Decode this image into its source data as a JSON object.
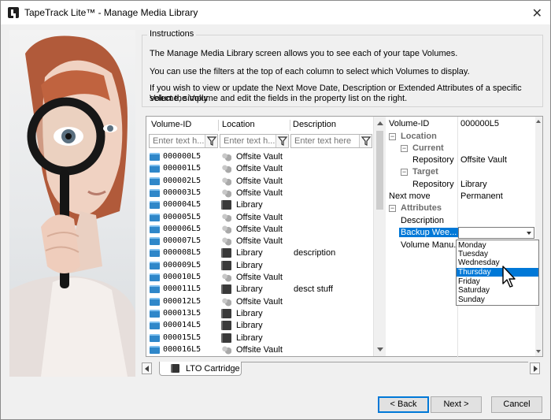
{
  "window": {
    "title": "TapeTrack Lite™ - Manage Media Library"
  },
  "instructions": {
    "legend": "Instructions",
    "p1": "The Manage Media Library screen allows you to see each of your tape Volumes.",
    "p2": "You can use the filters at the top of each column to select which Volumes to display.",
    "p3a": "If you wish to view or update the Next Move Date, Description or Extended Attributes of a specific Volume, simply",
    "p3b": "select the Volume and edit the fields in the property list on the right."
  },
  "grid": {
    "columns": [
      "Volume-ID",
      "Location",
      "Description"
    ],
    "filter_placeholders": [
      "Enter text h...",
      "Enter text h...",
      "Enter text here"
    ],
    "rows": [
      {
        "id": "000000L5",
        "location": "Offsite Vault",
        "loc_type": "offsite",
        "description": ""
      },
      {
        "id": "000001L5",
        "location": "Offsite Vault",
        "loc_type": "offsite",
        "description": ""
      },
      {
        "id": "000002L5",
        "location": "Offsite Vault",
        "loc_type": "offsite",
        "description": ""
      },
      {
        "id": "000003L5",
        "location": "Offsite Vault",
        "loc_type": "offsite",
        "description": ""
      },
      {
        "id": "000004L5",
        "location": "Library",
        "loc_type": "library",
        "description": ""
      },
      {
        "id": "000005L5",
        "location": "Offsite Vault",
        "loc_type": "offsite",
        "description": ""
      },
      {
        "id": "000006L5",
        "location": "Offsite Vault",
        "loc_type": "offsite",
        "description": ""
      },
      {
        "id": "000007L5",
        "location": "Offsite Vault",
        "loc_type": "offsite",
        "description": ""
      },
      {
        "id": "000008L5",
        "location": "Library",
        "loc_type": "library",
        "description": "description"
      },
      {
        "id": "000009L5",
        "location": "Library",
        "loc_type": "library",
        "description": ""
      },
      {
        "id": "000010L5",
        "location": "Offsite Vault",
        "loc_type": "offsite",
        "description": ""
      },
      {
        "id": "000011L5",
        "location": "Library",
        "loc_type": "library",
        "description": "desct stuff"
      },
      {
        "id": "000012L5",
        "location": "Offsite Vault",
        "loc_type": "offsite",
        "description": ""
      },
      {
        "id": "000013L5",
        "location": "Library",
        "loc_type": "library",
        "description": ""
      },
      {
        "id": "000014L5",
        "location": "Library",
        "loc_type": "library",
        "description": ""
      },
      {
        "id": "000015L5",
        "location": "Library",
        "loc_type": "library",
        "description": ""
      },
      {
        "id": "000016L5",
        "location": "Offsite Vault",
        "loc_type": "offsite",
        "description": ""
      }
    ]
  },
  "properties": {
    "volume_id_label": "Volume-ID",
    "volume_id_value": "000000L5",
    "location_cat": "Location",
    "current_cat": "Current",
    "repository_label": "Repository",
    "current_repository": "Offsite Vault",
    "target_cat": "Target",
    "target_repository": "Library",
    "next_move_label": "Next move",
    "next_move_value": "Permanent",
    "attributes_cat": "Attributes",
    "description_label": "Description",
    "backup_label": "Backup Wee...",
    "volume_manu_label": "Volume Manu...",
    "expanders": [
      "−",
      "−",
      "−",
      "−"
    ]
  },
  "dropdown": {
    "options": [
      "Monday",
      "Tuesday",
      "Wednesday",
      "Thursday",
      "Friday",
      "Saturday",
      "Sunday"
    ],
    "selected": "Thursday"
  },
  "tabs": {
    "active": "LTO Cartridge"
  },
  "buttons": {
    "back": "< Back",
    "next": "Next >",
    "cancel": "Cancel"
  },
  "icons": {
    "app": "tapetrack-app-icon",
    "close": "close-icon",
    "filter": "funnel-icon",
    "volume": "tape-volume-icon",
    "offsite": "offsite-vault-icon",
    "library": "library-icon",
    "cursor": "mouse-pointer-icon"
  },
  "colors": {
    "selection": "#0078d7",
    "volume_icon": "#2f87c9",
    "window_bg": "#f0f0f0"
  }
}
